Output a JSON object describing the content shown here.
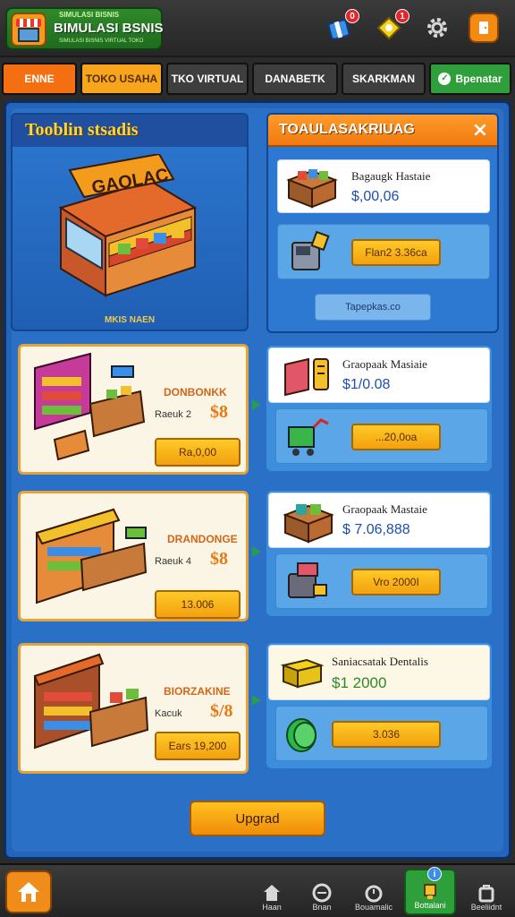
{
  "header": {
    "logo_small": "SIMULASI BISNIS",
    "logo_title": "BIMULASI BSNIS",
    "logo_sub": "SIMULASI BISNIS VIRTUAL TOKO",
    "notif_badge_1": "0",
    "notif_badge_2": "1"
  },
  "tabs": [
    {
      "label": "ENNE",
      "bg": "#f36f12",
      "color": "#fff"
    },
    {
      "label": "TOKO USAHA",
      "bg": "#f7a51c",
      "color": "#5a2c00"
    },
    {
      "label": "TKO VIRTUAL",
      "bg": "#3e3e3e",
      "color": "#fff"
    },
    {
      "label": "DANABETK",
      "bg": "#3e3e3e",
      "color": "#fff"
    },
    {
      "label": "SKARKMAN",
      "bg": "#3e3e3e",
      "color": "#fff"
    },
    {
      "label": "Bpenatar",
      "bg": "#2e9f3a",
      "color": "#fff"
    }
  ],
  "feature": {
    "title": "Tooblin stsadis",
    "sign": "GAOLAC",
    "caption": "MKIS NAEN"
  },
  "right_panel": {
    "title": "TOAULASAKRIUAG",
    "close": "×",
    "group1": {
      "name": "Bagaugk Hastaie",
      "price": "$,00,06",
      "button": "Flan2 3.36ca",
      "sub_button": "Tapepkas.co"
    },
    "group2": {
      "name": "Graopaak Masiaie",
      "price": "$1/0.08",
      "button": "...20,0oa"
    },
    "group3": {
      "name": "Graopaak Mastaie",
      "price": "$ 7.06,888",
      "button": "Vro 2000I"
    },
    "group4": {
      "name": "Saniacsatak Dentalis",
      "price": "$1 2000",
      "button": "3.036"
    }
  },
  "shops": [
    {
      "name": "DONBONKK",
      "level": "Raeuk 2",
      "cost": "$8",
      "button": "Ra,0,00"
    },
    {
      "name": "DRANDONGE",
      "level": "Raeuk 4",
      "cost": "$8",
      "button": "13.006"
    },
    {
      "name": "BIORZAKINE",
      "level": "Kacuk",
      "cost": "$/8",
      "button": "Ears 19,200"
    }
  ],
  "upgrade_label": "Upgrad",
  "bottom_nav": [
    {
      "label": "Haan"
    },
    {
      "label": "Bnan"
    },
    {
      "label": "Bouamalic"
    },
    {
      "label": "Bottalani"
    },
    {
      "label": "Beeliidnt"
    }
  ],
  "colors": {
    "panel_blue": "#2a70c7",
    "orange": "#f7a51c",
    "green": "#2e9f3a",
    "price_blue": "#1c4fb0"
  }
}
